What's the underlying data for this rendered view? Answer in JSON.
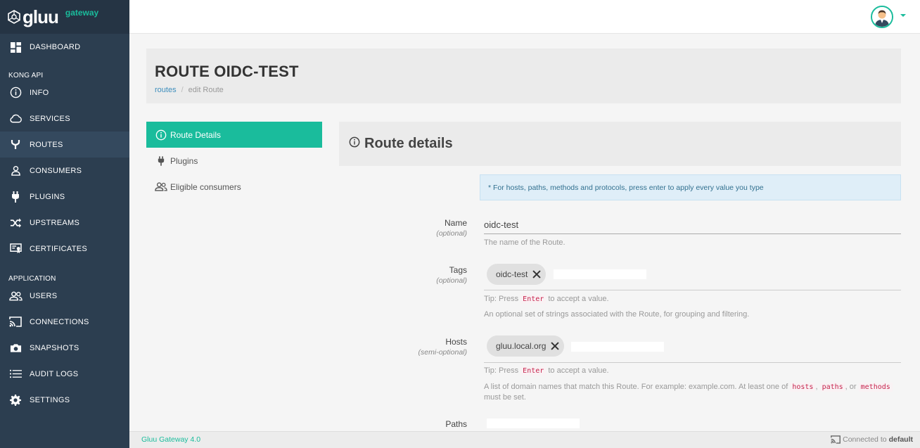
{
  "brand": {
    "name": "gluu",
    "subtitle": "gateway"
  },
  "sidebar": {
    "items": [
      {
        "label": "DASHBOARD",
        "icon": "dashboard-icon"
      },
      {
        "label": "INFO",
        "icon": "info-icon"
      },
      {
        "label": "SERVICES",
        "icon": "cloud-icon"
      },
      {
        "label": "ROUTES",
        "icon": "routes-icon",
        "active": true
      },
      {
        "label": "CONSUMERS",
        "icon": "user-icon"
      },
      {
        "label": "PLUGINS",
        "icon": "plug-icon"
      },
      {
        "label": "UPSTREAMS",
        "icon": "shuffle-icon"
      },
      {
        "label": "CERTIFICATES",
        "icon": "certificate-icon"
      },
      {
        "label": "USERS",
        "icon": "users-icon"
      },
      {
        "label": "CONNECTIONS",
        "icon": "cast-icon"
      },
      {
        "label": "SNAPSHOTS",
        "icon": "camera-icon"
      },
      {
        "label": "AUDIT LOGS",
        "icon": "list-icon"
      },
      {
        "label": "SETTINGS",
        "icon": "gear-icon"
      }
    ],
    "sections": {
      "kong": "KONG API",
      "application": "APPLICATION"
    }
  },
  "header": {
    "title": "ROUTE OIDC-TEST",
    "breadcrumb": {
      "link": "routes",
      "current": "edit Route"
    }
  },
  "left_menu": [
    {
      "label": "Route Details",
      "icon": "info-icon",
      "active": true
    },
    {
      "label": "Plugins",
      "icon": "plug-icon"
    },
    {
      "label": "Eligible consumers",
      "icon": "users-icon"
    }
  ],
  "content": {
    "title": "Route details",
    "info": "* For hosts, paths, methods and protocols, press enter to apply every value you type"
  },
  "form": {
    "name": {
      "label": "Name",
      "hint": "(optional)",
      "value": "oidc-test",
      "help": "The name of the Route."
    },
    "tags": {
      "label": "Tags",
      "hint": "(optional)",
      "chip": "oidc-test",
      "tip_pre": "Tip: Press",
      "tip_key": "Enter",
      "tip_post": "to accept a value.",
      "help": "An optional set of strings associated with the Route, for grouping and filtering."
    },
    "hosts": {
      "label": "Hosts",
      "hint": "(semi-optional)",
      "chip": "gluu.local.org",
      "tip_pre": "Tip: Press",
      "tip_key": "Enter",
      "tip_post": "to accept a value.",
      "help_pre": "A list of domain names that match this Route. For example: example.com. At least one of",
      "code1": "hosts",
      "sep1": ",",
      "code2": "paths",
      "sep2": ", or",
      "code3": "methods",
      "help_post": "must be set."
    },
    "paths": {
      "label": "Paths"
    }
  },
  "footer": {
    "version": "Gluu Gateway 4.0",
    "conn_label": "Connected to",
    "conn_value": "default"
  },
  "colors": {
    "sidebar": "#2c3e50",
    "accent": "#1abc9c",
    "link": "#3c8dbc"
  }
}
